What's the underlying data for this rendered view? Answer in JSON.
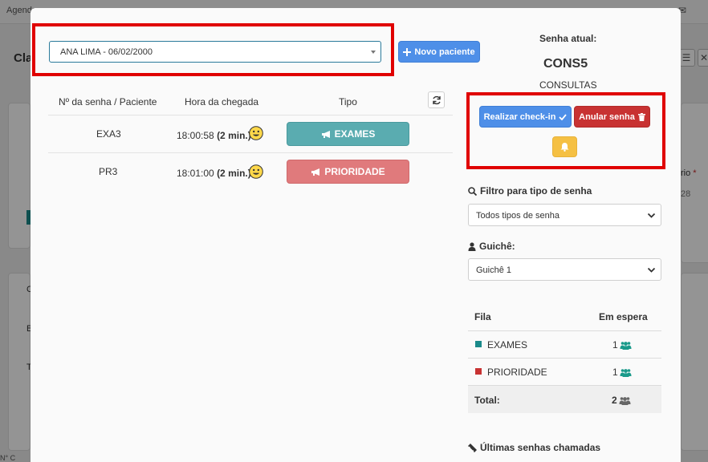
{
  "background": {
    "nav_items": [
      "Agenda"
    ],
    "page_title": "Cla",
    "field_label": "rio",
    "field_value": "28",
    "left_labels": [
      "C",
      "B",
      "T"
    ],
    "bottom_text": "N° C"
  },
  "patient_select": {
    "value": "ANA LIMA - 06/02/2000"
  },
  "toolbar": {
    "novo_paciente_label": "Novo paciente"
  },
  "table": {
    "headers": [
      "Nº da senha / Paciente",
      "Hora da chegada",
      "Tipo"
    ],
    "rows": [
      {
        "senha": "EXA3",
        "hora": "18:00:58",
        "espera": "(2 min.)",
        "tipo": "EXAMES"
      },
      {
        "senha": "PR3",
        "hora": "18:01:00",
        "espera": "(2 min.)",
        "tipo": "PRIORIDADE"
      }
    ]
  },
  "current": {
    "label": "Senha atual:",
    "code": "CONS5",
    "category": "CONSULTAS"
  },
  "actions": {
    "checkin_label": "Realizar check-in",
    "anular_label": "Anular senha"
  },
  "filter": {
    "label": "Filtro para tipo de senha",
    "value": "Todos tipos de senha"
  },
  "guiche": {
    "label": "Guichê:",
    "value": "Guichê 1"
  },
  "queue": {
    "headers": [
      "Fila",
      "Em espera"
    ],
    "rows": [
      {
        "name": "EXAMES",
        "count": "1",
        "color": "#1a8a8a"
      },
      {
        "name": "PRIORIDADE",
        "count": "1",
        "color": "#c83232"
      }
    ],
    "total_label": "Total:",
    "total_count": "2"
  },
  "ultimas": {
    "label": "Últimas senhas chamadas"
  },
  "colors": {
    "primary": "#4e8fe8",
    "danger": "#c83232",
    "warning": "#f5c043",
    "teal": "#5aacb0",
    "pink": "#e07a7c",
    "highlight": "#e00000"
  }
}
